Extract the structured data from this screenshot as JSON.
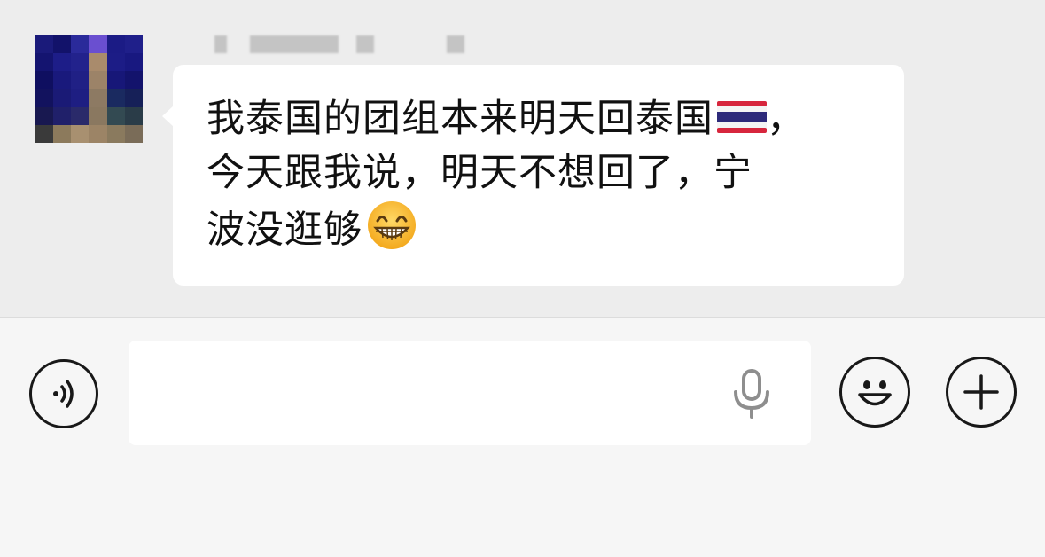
{
  "conversation": {
    "incoming_message": {
      "line_1": "我泰国的团组本来明天回泰国",
      "line_1_suffix": "，",
      "line_2": "今天跟我说，明天不想回了，宁",
      "line_3": "波没逛够",
      "inline_emojis": [
        "thailand-flag-icon",
        "grinning-face-icon"
      ]
    },
    "sender": {
      "name_obscured": true,
      "avatar_obscured": true
    }
  },
  "input_bar": {
    "text_value": "",
    "placeholder": "",
    "icons": [
      "voice-mode-icon",
      "microphone-icon",
      "emoji-icon",
      "plus-icon"
    ]
  },
  "colors": {
    "chat_background": "#ededed",
    "bubble_background": "#ffffff",
    "input_bar_background": "#f6f6f6",
    "text": "#111111",
    "icon_stroke": "#181818"
  }
}
